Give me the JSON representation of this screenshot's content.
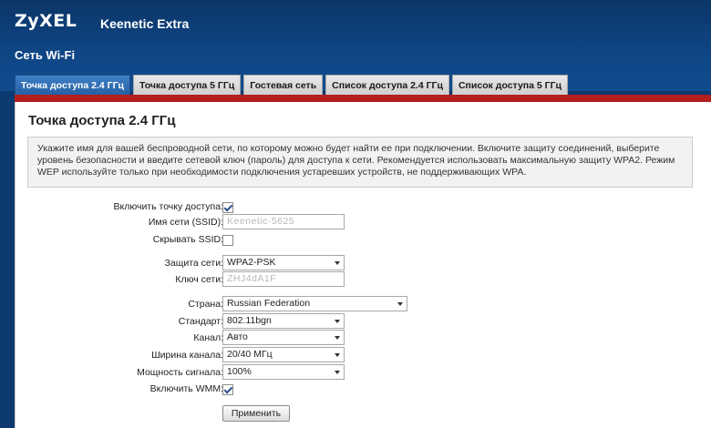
{
  "header": {
    "logo": "ZyXEL",
    "model": "Keenetic Extra",
    "section_title": "Сеть Wi-Fi"
  },
  "tabs": [
    {
      "label": "Точка доступа 2.4 ГГц",
      "active": true
    },
    {
      "label": "Точка доступа 5 ГГц",
      "active": false
    },
    {
      "label": "Гостевая сеть",
      "active": false
    },
    {
      "label": "Список доступа 2.4 ГГц",
      "active": false
    },
    {
      "label": "Список доступа 5 ГГц",
      "active": false
    }
  ],
  "panel": {
    "title": "Точка доступа 2.4 ГГц",
    "info": "Укажите имя для вашей беспроводной сети, по которому можно будет найти ее при подключении. Включите защиту соединений, выберите уровень безопасности и введите сетевой ключ (пароль) для доступа к сети. Рекомендуется использовать максимальную защиту WPA2. Режим WEP используйте только при необходимости подключения устаревших устройств, не поддерживающих WPA."
  },
  "form": {
    "enable_ap_label": "Включить точку доступа:",
    "enable_ap_checked": true,
    "ssid_label": "Имя сети (SSID):",
    "ssid_value": "Keenetic-5625",
    "hide_ssid_label": "Скрывать SSID:",
    "hide_ssid_checked": false,
    "security_label": "Защита сети:",
    "security_value": "WPA2-PSK",
    "key_label": "Ключ сети:",
    "key_value": "ZHJ4dA1F",
    "country_label": "Страна:",
    "country_value": "Russian Federation",
    "standard_label": "Стандарт:",
    "standard_value": "802.11bgn",
    "channel_label": "Канал:",
    "channel_value": "Авто",
    "width_label": "Ширина канала:",
    "width_value": "20/40 МГц",
    "power_label": "Мощность сигнала:",
    "power_value": "100%",
    "wmm_label": "Включить WMM:",
    "wmm_checked": true,
    "apply_label": "Применить"
  }
}
